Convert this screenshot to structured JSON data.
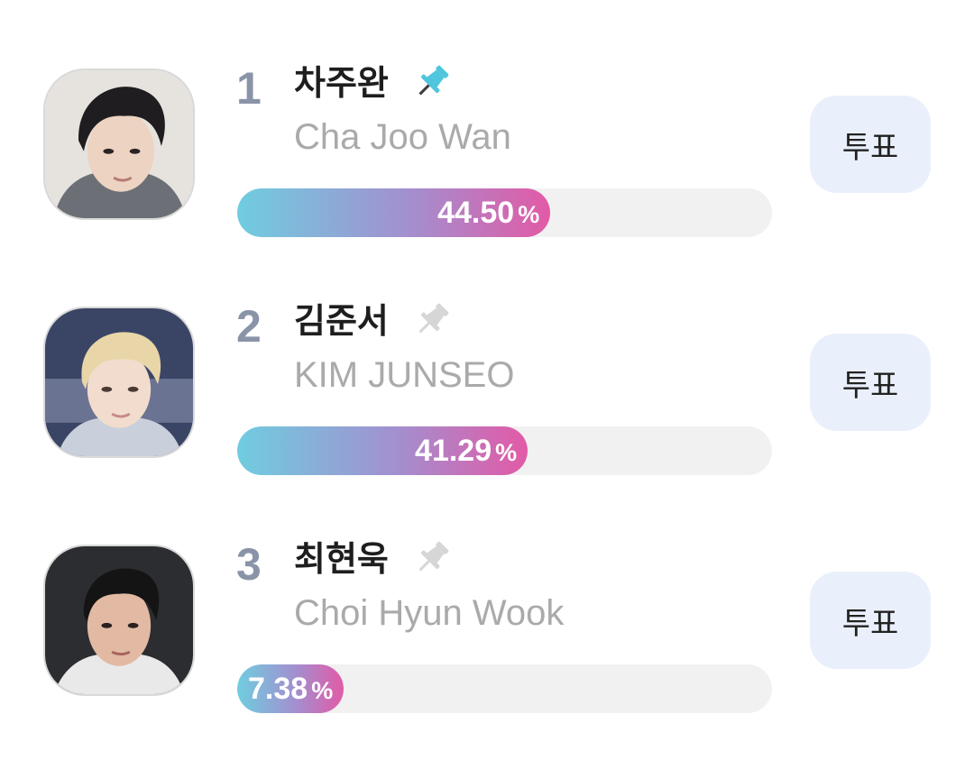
{
  "colors": {
    "rank": "#8a94a8",
    "pin_active": "#4fc6dd",
    "pin_inactive": "#d6d6d6",
    "bar_track": "#f1f1f1",
    "bar_gradient_start": "#6fcde0",
    "bar_gradient_end": "#e25aa6",
    "vote_button_bg": "#eaf0fb"
  },
  "candidates": [
    {
      "rank": "1",
      "name_ko": "차주완",
      "name_en": "Cha Joo Wan",
      "percent_value": "44.50",
      "percent_sign": "%",
      "share": 44.5,
      "pinned": true,
      "pin_icon": "pin-icon",
      "vote_label": "투표"
    },
    {
      "rank": "2",
      "name_ko": "김준서",
      "name_en": "KIM JUNSEO",
      "percent_value": "41.29",
      "percent_sign": "%",
      "share": 41.29,
      "pinned": false,
      "pin_icon": "pin-icon",
      "vote_label": "투표"
    },
    {
      "rank": "3",
      "name_ko": "최현욱",
      "name_en": "Choi Hyun Wook",
      "percent_value": "7.38",
      "percent_sign": "%",
      "share": 7.38,
      "pinned": false,
      "pin_icon": "pin-icon",
      "vote_label": "투표"
    }
  ]
}
